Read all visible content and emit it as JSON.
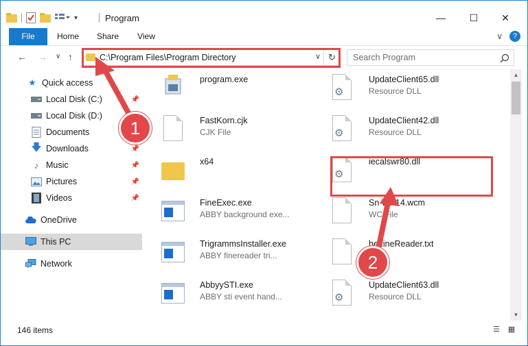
{
  "window": {
    "title": "Program",
    "controls": {
      "minimize": "—",
      "maximize": "☐",
      "close": "✕"
    }
  },
  "ribbon": {
    "tabs": [
      "File",
      "Home",
      "Share",
      "View"
    ],
    "expand": "∨",
    "help": "?"
  },
  "navigation": {
    "back": "←",
    "forward": "→",
    "recent": "∨",
    "up": "↑",
    "address": "C:\\Program Files\\Program Directory",
    "dropdown": "∨",
    "refresh": "↻",
    "search_placeholder": "Search Program"
  },
  "sidebar": {
    "items": [
      {
        "label": "Quick access",
        "icon": "star-icon",
        "pinned": false
      },
      {
        "label": "Local Disk (C:)",
        "icon": "drive-icon",
        "pinned": true
      },
      {
        "label": "Local Disk (D:)",
        "icon": "drive-icon",
        "pinned": true
      },
      {
        "label": "Documents",
        "icon": "documents-icon",
        "pinned": true
      },
      {
        "label": "Downloads",
        "icon": "download-icon",
        "pinned": true
      },
      {
        "label": "Music",
        "icon": "music-icon",
        "pinned": true
      },
      {
        "label": "Pictures",
        "icon": "pictures-icon",
        "pinned": true
      },
      {
        "label": "Videos",
        "icon": "videos-icon",
        "pinned": true
      },
      {
        "label": "OneDrive",
        "icon": "cloud-icon",
        "pinned": false
      },
      {
        "label": "This PC",
        "icon": "computer-icon",
        "pinned": false,
        "selected": true
      },
      {
        "label": "Network",
        "icon": "network-icon",
        "pinned": false
      }
    ]
  },
  "files": [
    {
      "name": "program.exe",
      "desc": "",
      "type": "installer"
    },
    {
      "name": "UpdateClient65.dll",
      "desc": "Resource DLL",
      "type": "dll"
    },
    {
      "name": "FastKorn.cjk",
      "desc": "CJK File",
      "type": "doc"
    },
    {
      "name": "UpdateClient42.dll",
      "desc": "Resource DLL",
      "type": "dll"
    },
    {
      "name": "x64",
      "desc": "",
      "type": "folder"
    },
    {
      "name": "iecalswr80.dll",
      "desc": "",
      "type": "dll"
    },
    {
      "name": "FineExec.exe",
      "desc": "ABBY background exe...",
      "type": "exe"
    },
    {
      "name": "Sn   WP14.wcm",
      "desc": "WC   File",
      "type": "doc"
    },
    {
      "name": "TrigrammsInstaller.exe",
      "desc": "ABBY finereader tri...",
      "type": "exe"
    },
    {
      "name": "he   fineReader.txt",
      "desc": "   ile",
      "type": "doc"
    },
    {
      "name": "AbbyySTI.exe",
      "desc": "ABBY sti event hand...",
      "type": "exe"
    },
    {
      "name": "UpdateClient63.dll",
      "desc": "Resource DLL",
      "type": "dll"
    }
  ],
  "status": {
    "items_count": "146 items"
  },
  "annotations": {
    "step1": "1",
    "step2": "2",
    "color": "#e0484a"
  }
}
